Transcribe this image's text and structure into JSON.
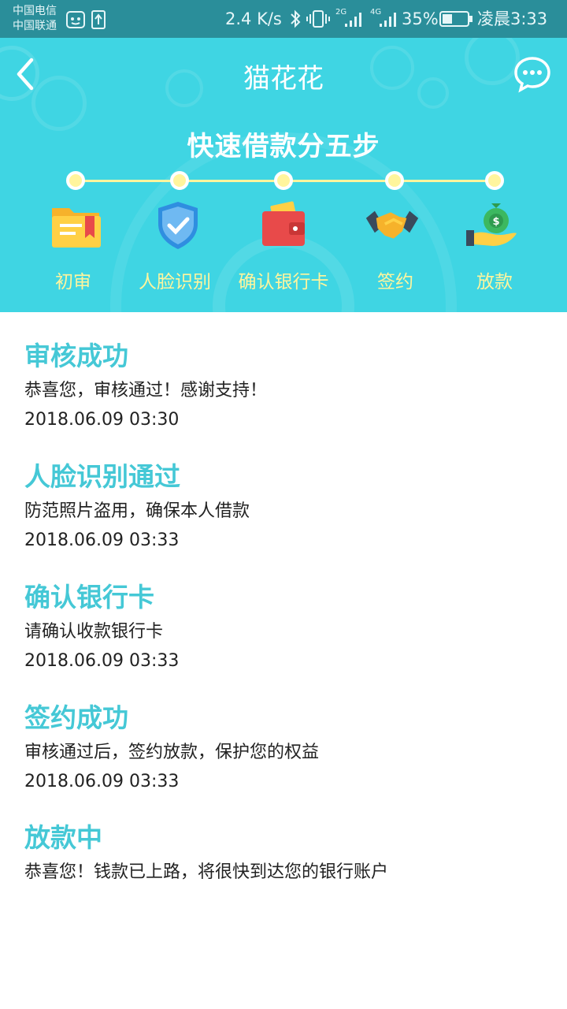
{
  "status_bar": {
    "carrier_1": "中国电信",
    "carrier_2": "中国联通",
    "speed": "2.4 K/s",
    "net_2g": "2G",
    "net_4g": "4G",
    "battery": "35%",
    "time": "凌晨3:33"
  },
  "nav": {
    "title": "猫花花"
  },
  "steps": {
    "title": "快速借款分五步",
    "items": [
      {
        "label": "初审"
      },
      {
        "label": "人脸识别"
      },
      {
        "label": "确认银行卡"
      },
      {
        "label": "签约"
      },
      {
        "label": "放款"
      }
    ]
  },
  "progress": {
    "items": [
      {
        "title": "审核成功",
        "desc": "恭喜您，审核通过！感谢支持！",
        "time": "2018.06.09  03:30"
      },
      {
        "title": "人脸识别通过",
        "desc": "防范照片盗用，确保本人借款",
        "time": "2018.06.09  03:33"
      },
      {
        "title": "确认银行卡",
        "desc": "请确认收款银行卡",
        "time": "2018.06.09  03:33"
      },
      {
        "title": "签约成功",
        "desc": "审核通过后，签约放款，保护您的权益",
        "time": "2018.06.09  03:33"
      },
      {
        "title": "放款中",
        "desc": "恭喜您！钱款已上路，将很快到达您的银行账户"
      }
    ]
  },
  "colors": {
    "header_bg": "#3fd5e3",
    "status_bg": "#2a8e9a",
    "accent_title": "#45c8d6",
    "step_label": "#fff59d"
  }
}
